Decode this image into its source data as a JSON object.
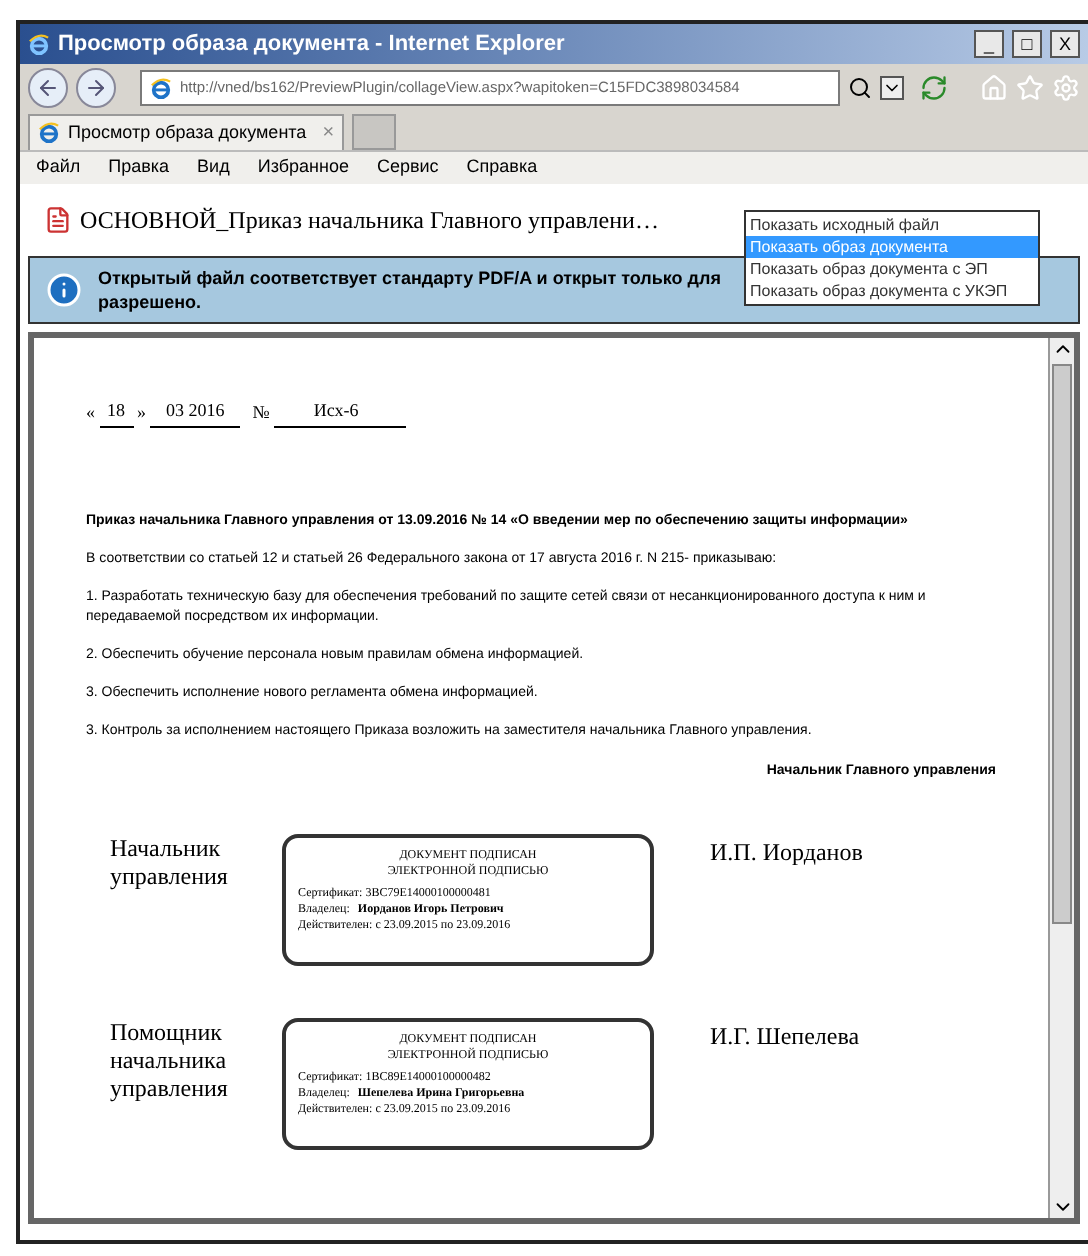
{
  "window": {
    "title": "Просмотр образа документа - Internet Explorer",
    "controls": [
      "_",
      "□",
      "X"
    ]
  },
  "address_bar": {
    "url": "http://vned/bs162/PreviewPlugin/collageView.aspx?wapitoken=C15FDC3898034584"
  },
  "tabs": [
    {
      "label": "Просмотр образа документа",
      "close": "×",
      "selected": true
    }
  ],
  "menu": [
    "Файл",
    "Правка",
    "Вид",
    "Избранное",
    "Сервис",
    "Справка"
  ],
  "document_title": "ОСНОВНОЙ_Приказ начальника Главного управлени…",
  "view_menu": {
    "options": [
      {
        "label": "Показать исходный файл",
        "selected": false
      },
      {
        "label": "Показать образ документа",
        "selected": true
      },
      {
        "label": "Показать образ документа с ЭП",
        "selected": false
      },
      {
        "label": "Показать образ документа с УКЭП",
        "selected": false
      }
    ]
  },
  "info_bar": {
    "text": "Открытый файл соответствует стандарту PDF/A и открыт только для",
    "text_2": "разрешено."
  },
  "page": {
    "date_line": {
      "open_quote": "«",
      "day": "18",
      "close_quote": "»",
      "month_year": "03 2016",
      "number_sign": "№",
      "number": "Исх-6"
    },
    "heading": "Приказ начальника Главного управления от 13.09.2016 № 14 «О введении мер по обеспечению защиты информации»",
    "paragraphs": [
      "В соответствии со статьей 12 и статьей 26 Федерального закона от 17 августа 2016 г. N 215- приказываю:",
      "1. Разработать техническую базу для обеспечения требований по защите сетей связи от несанкционированного доступа к ним и передаваемой посредством их информации.",
      "2. Обеспечить обучение персонала новым правилам обмена информацией.",
      "3. Обеспечить исполнение нового регламента обмена информацией.",
      "3. Контроль за исполнением настоящего Приказа возложить на заместителя  начальника Главного управления."
    ],
    "signoff": "Начальник Главного управления",
    "signatures": [
      {
        "position": "Начальник управления",
        "stamp_title": "ДОКУМЕНТ ПОДПИСАН",
        "stamp_subtitle": "ЭЛЕКТРОННОЙ ПОДПИСЬЮ",
        "certificate": "Сертификат: 3BC79E14000100000481",
        "owner_label": "Владелец:",
        "owner": "Иорданов Игорь Петрович",
        "validity": "Действителен: с 23.09.2015 по 23.09.2016",
        "name": "И.П. Иорданов"
      },
      {
        "position": "Помощник начальника управления",
        "stamp_title": "ДОКУМЕНТ ПОДПИСАН",
        "stamp_subtitle": "ЭЛЕКТРОННОЙ ПОДПИСЬЮ",
        "certificate": "Сертификат: 1BC89E14000100000482",
        "owner_label": "Владелец:",
        "owner": "Шепелева Ирина Григорьевна",
        "validity": "Действителен: с 23.09.2015 по 23.09.2016",
        "name": "И.Г. Шепелева"
      }
    ]
  }
}
